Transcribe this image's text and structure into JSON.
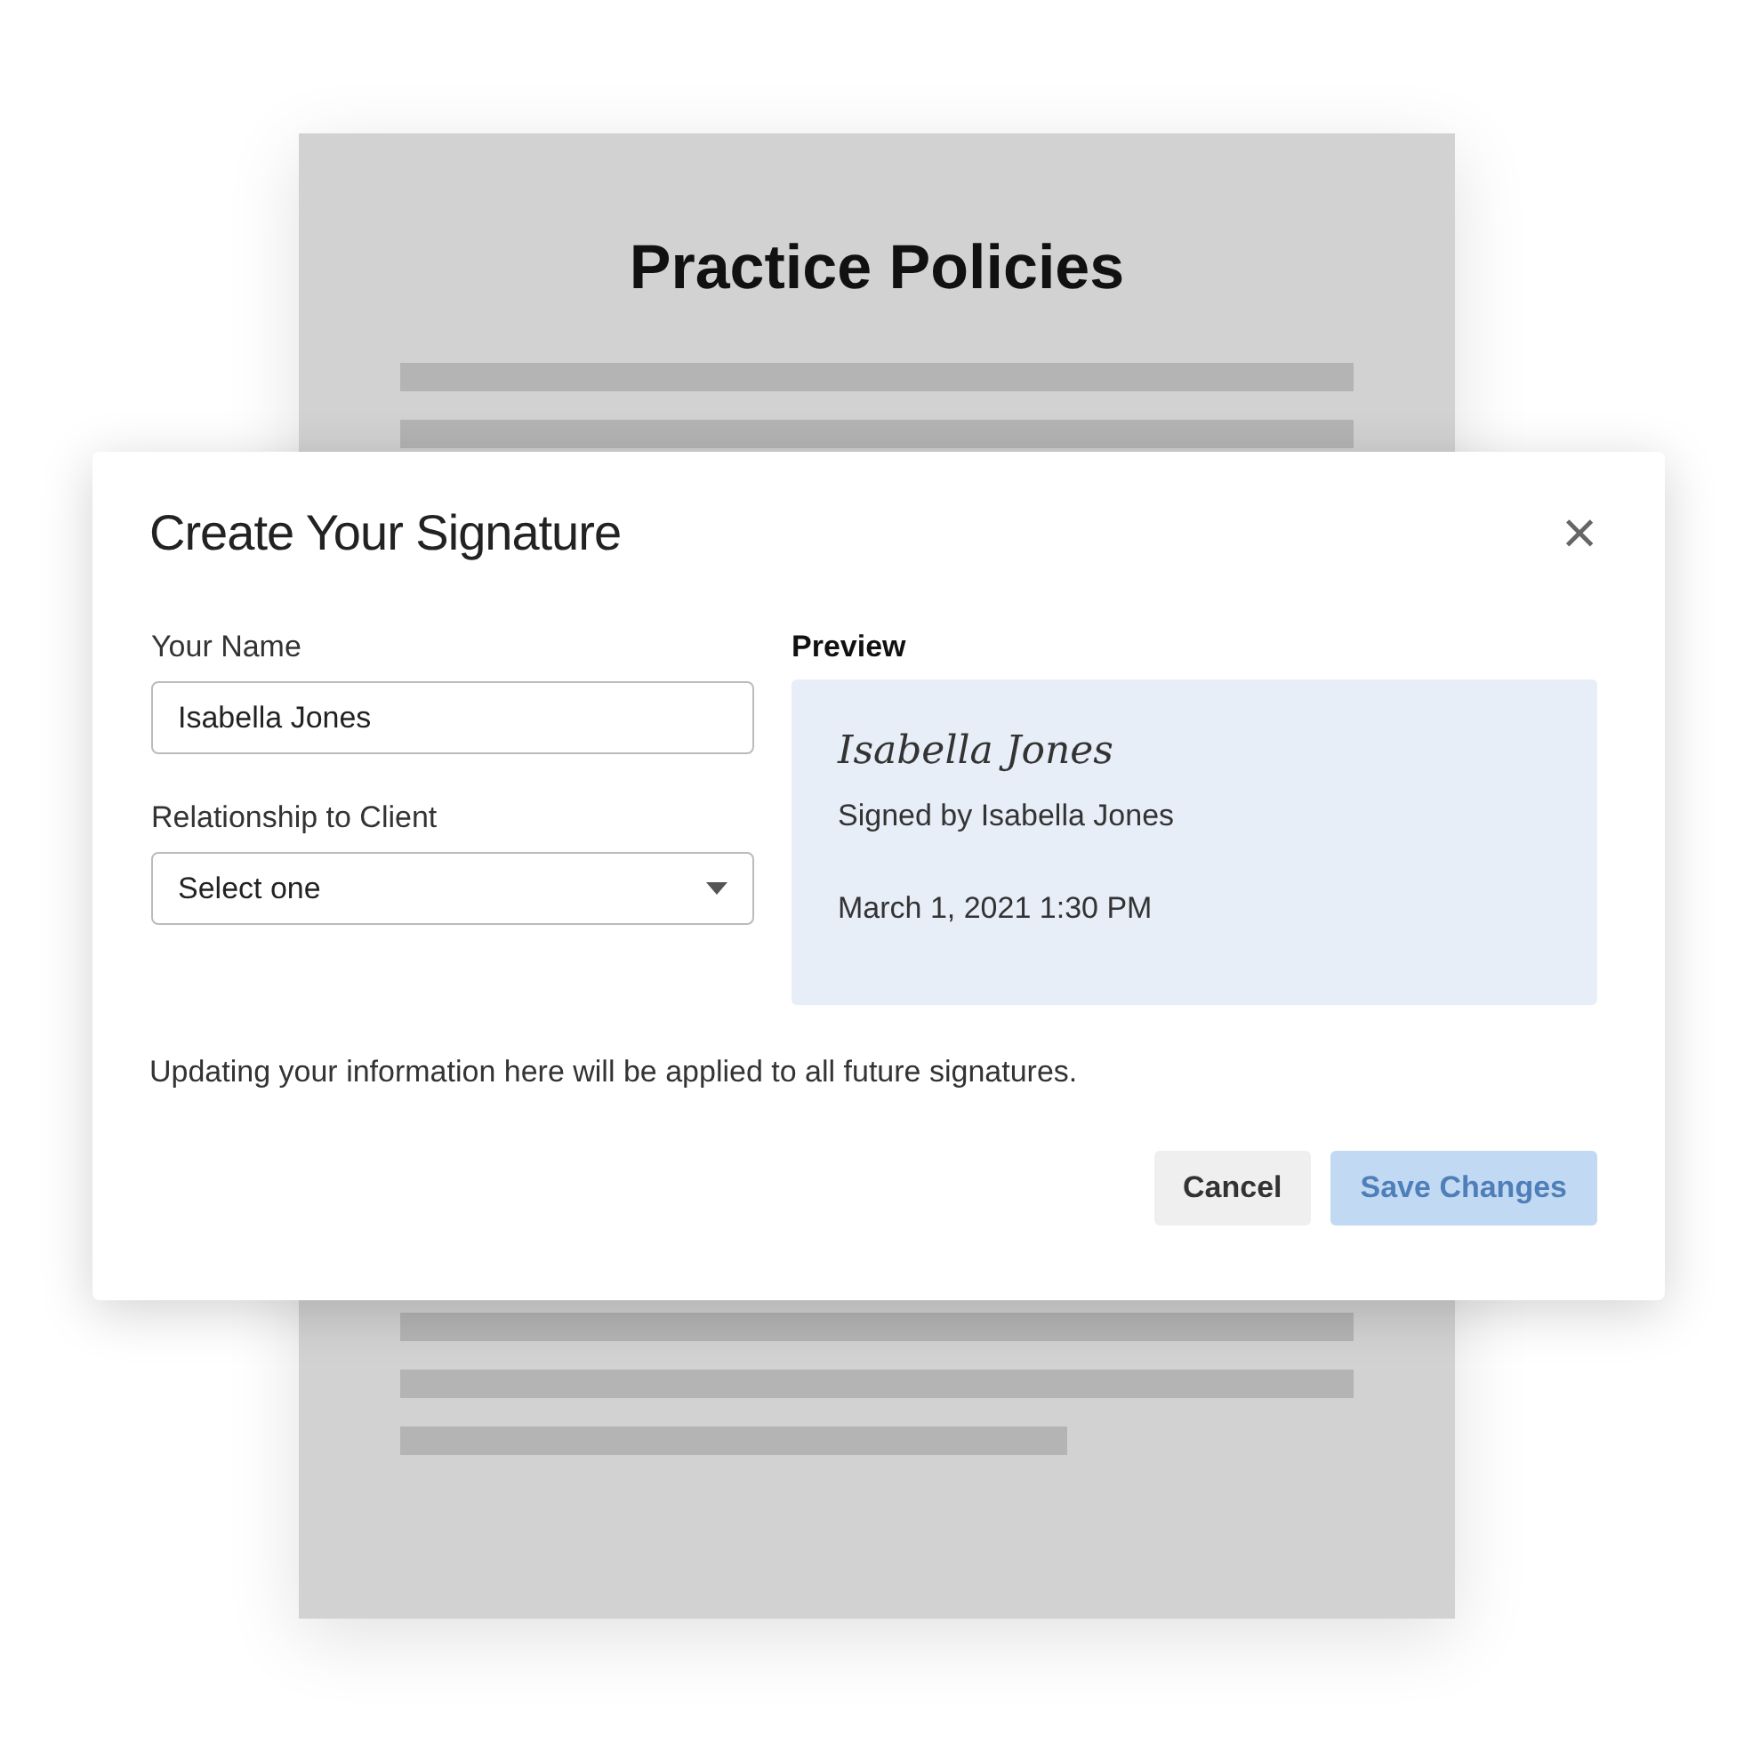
{
  "document": {
    "title": "Practice Policies"
  },
  "dialog": {
    "title": "Create Your Signature",
    "close": "×",
    "fields": [
      {
        "kind": "text",
        "label": "Your Name",
        "value": "Isabella Jones"
      },
      {
        "kind": "select",
        "label": "Relationship to Client",
        "value": "Select one"
      }
    ],
    "preview": {
      "label": "Preview",
      "signature": "Isabella Jones",
      "signed_by": "Signed by Isabella Jones",
      "date": "March 1, 2021 1:30 PM"
    },
    "note": "Updating your information here will be applied to all future signatures.",
    "buttons": [
      {
        "label": "Cancel",
        "kind": "secondary",
        "disabled": false
      },
      {
        "label": "Save Changes",
        "kind": "primary",
        "disabled": true
      }
    ]
  }
}
